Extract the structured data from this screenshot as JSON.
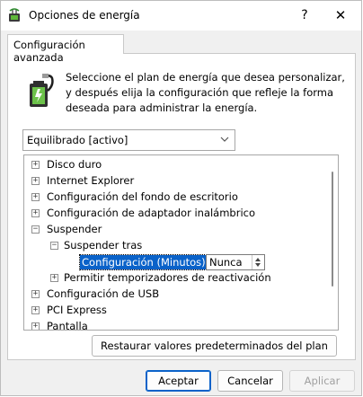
{
  "window": {
    "title": "Opciones de energía",
    "help_label": "?",
    "close_label": "✕",
    "icon": "power-options-icon"
  },
  "tab": {
    "label": "Configuración avanzada"
  },
  "description": "Seleccione el plan de energía que desea personalizar, y después elija la configuración que refleje la forma deseada para administrar la energía.",
  "plan_select": {
    "value": "Equilibrado [activo]"
  },
  "tree": {
    "rows": [
      {
        "label": "Disco duro",
        "expander": "+"
      },
      {
        "label": "Internet Explorer",
        "expander": "+"
      },
      {
        "label": "Configuración del fondo de escritorio",
        "expander": "+"
      },
      {
        "label": "Configuración de adaptador inalámbrico",
        "expander": "+"
      },
      {
        "label": "Suspender",
        "expander": "−"
      },
      {
        "label": "Suspender tras",
        "expander": "−"
      },
      {
        "label": "Configuración (Minutos):",
        "value": "Nunca"
      },
      {
        "label": "Permitir temporizadores de reactivación",
        "expander": "+"
      },
      {
        "label": "Configuración de USB",
        "expander": "+"
      },
      {
        "label": "PCI Express",
        "expander": "+"
      },
      {
        "label": "Pantalla",
        "expander": "+"
      }
    ]
  },
  "buttons": {
    "restore": "Restaurar valores predeterminados del plan",
    "accept": "Aceptar",
    "cancel": "Cancelar",
    "apply": "Aplicar"
  },
  "colors": {
    "selection": "#0a62c9",
    "primary_border": "#0a62c9"
  }
}
